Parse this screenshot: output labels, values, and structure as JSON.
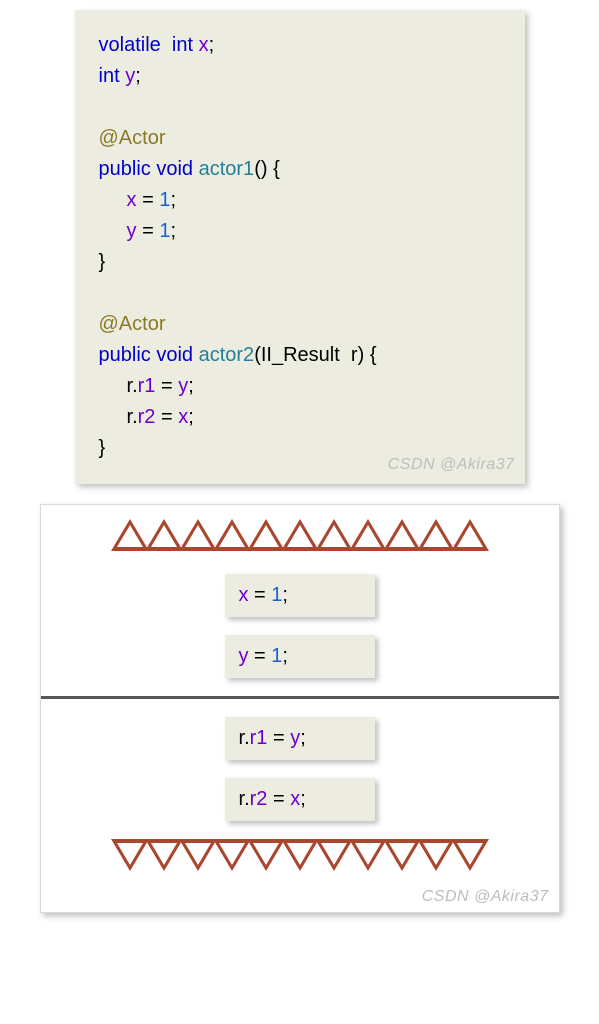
{
  "code": {
    "volatile": "volatile",
    "int1": "int",
    "x": "x",
    "int2": "int",
    "y": "y",
    "semi": ";",
    "ann": "@Actor",
    "public": "public",
    "void": "void",
    "actor1": "actor1",
    "lp": "(",
    "rp": ")",
    "lb": "{",
    "rb": "}",
    "eq": "=",
    "one": "1",
    "actor2": "actor2",
    "iiresult": "II_Result",
    "rparam": "r",
    "dot": ".",
    "r1": "r1",
    "r2": "r2"
  },
  "diagram": {
    "stmt1_x": "x",
    "stmt1_eq": " = ",
    "stmt1_v": "1",
    "stmt1_semi": ";",
    "stmt2_y": "y",
    "stmt2_eq": " = ",
    "stmt2_v": "1",
    "stmt2_semi": ";",
    "stmt3_r": "r",
    "stmt3_dot": ".",
    "stmt3_f": "r1",
    "stmt3_eq": " = ",
    "stmt3_v": "y",
    "stmt3_semi": ";",
    "stmt4_r": "r",
    "stmt4_dot": ".",
    "stmt4_f": "r2",
    "stmt4_eq": " = ",
    "stmt4_v": "x",
    "stmt4_semi": ";"
  },
  "watermark": "CSDN @Akira37"
}
